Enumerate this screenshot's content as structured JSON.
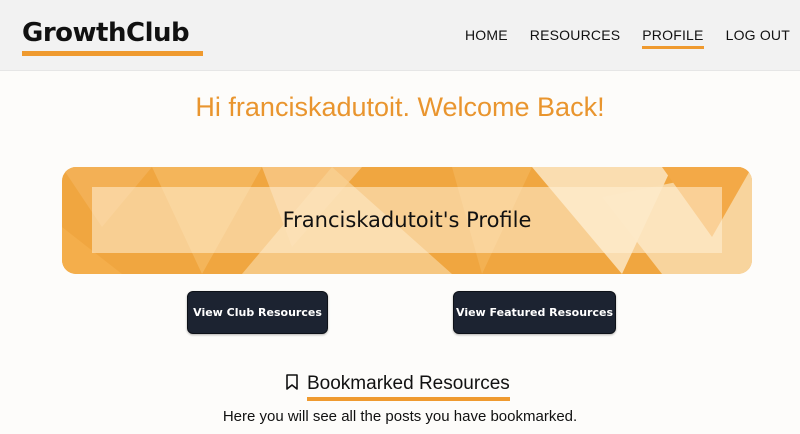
{
  "header": {
    "logo": "GrowthClub",
    "nav": [
      {
        "label": "HOME"
      },
      {
        "label": "RESOURCES"
      },
      {
        "label": "PROFILE",
        "active": true
      },
      {
        "label": "LOG OUT"
      }
    ]
  },
  "welcome": "Hi franciskadutoit. Welcome Back!",
  "banner": {
    "title": "Franciskadutoit's Profile"
  },
  "buttons": {
    "club_resources": "View Club Resources",
    "featured_resources": "View Featured Resources"
  },
  "bookmarks": {
    "icon": "bookmark-icon",
    "title": "Bookmarked Resources",
    "description": "Here you will see all the posts you have bookmarked."
  },
  "colors": {
    "accent": "#ef9a2f",
    "welcome_text": "#e9952e",
    "button_bg": "#1c2331",
    "header_bg": "#f2f2f2"
  }
}
